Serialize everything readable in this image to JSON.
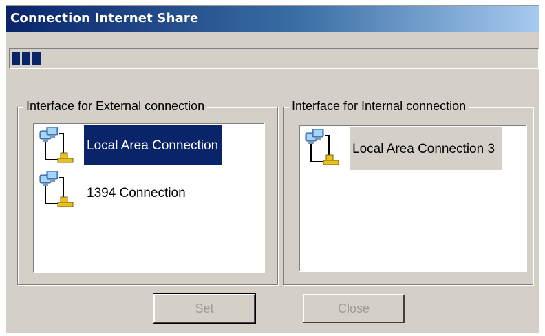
{
  "window": {
    "title": "Connection Internet Share"
  },
  "progress": {
    "blocks": 3
  },
  "external": {
    "legend": "Interface for External connection",
    "items": [
      {
        "label": "Local Area Connection",
        "icon": "network-connection-icon",
        "selected": true
      },
      {
        "label": "1394 Connection",
        "icon": "network-connection-icon",
        "selected": false
      }
    ]
  },
  "internal": {
    "legend": "Interface for Internal connection",
    "items": [
      {
        "label": "Local Area Connection 3",
        "icon": "network-connection-icon",
        "selected": true
      }
    ]
  },
  "buttons": {
    "set_label": "Set",
    "close_label": "Close"
  },
  "colors": {
    "selection": "#0a246a",
    "face": "#d4d0c8",
    "disabled_text": "#9c9a94"
  }
}
